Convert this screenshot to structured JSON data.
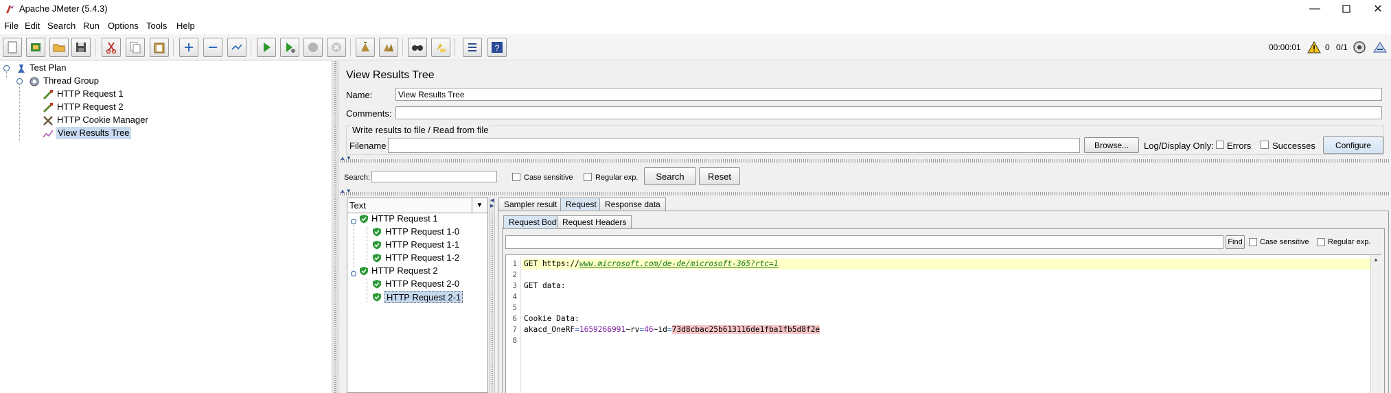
{
  "window": {
    "title": "Apache JMeter (5.4.3)"
  },
  "menu": [
    "File",
    "Edit",
    "Search",
    "Run",
    "Options",
    "Tools",
    "Help"
  ],
  "status": {
    "timer": "00:00:01",
    "warnings": "0",
    "threads": "0/1"
  },
  "tree": {
    "test_plan": "Test Plan",
    "thread_group": "Thread Group",
    "req1": "HTTP Request 1",
    "req2": "HTTP Request 2",
    "cookie": "HTTP Cookie Manager",
    "results": "View Results Tree"
  },
  "panel": {
    "title": "View Results Tree",
    "name_label": "Name:",
    "name_value": "View Results Tree",
    "comments_label": "Comments:",
    "write_title": "Write results to file / Read from file",
    "filename_label": "Filename",
    "browse": "Browse...",
    "log_display": "Log/Display Only:",
    "errors": "Errors",
    "successes": "Successes",
    "configure": "Configure",
    "search_label": "Search:",
    "case_sensitive": "Case sensitive",
    "regex": "Regular exp.",
    "search_btn": "Search",
    "reset_btn": "Reset"
  },
  "results": {
    "renderer": "Text",
    "items": [
      "HTTP Request 1",
      "HTTP Request 1-0",
      "HTTP Request 1-1",
      "HTTP Request 1-2",
      "HTTP Request 2",
      "HTTP Request 2-0",
      "HTTP Request 2-1"
    ]
  },
  "tabs": {
    "sampler": "Sampler result",
    "request": "Request",
    "response": "Response data",
    "request_body": "Request Body",
    "request_headers": "Request Headers"
  },
  "find": {
    "button": "Find",
    "case_sensitive": "Case sensitive",
    "regex": "Regular exp."
  },
  "body": {
    "line_numbers": [
      "1",
      "2",
      "3",
      "4",
      "5",
      "6",
      "7",
      "8"
    ],
    "l1_method": "GET https://",
    "l1_url": "www.microsoft.com/de-de/microsoft-365?rtc=1",
    "l3": "GET data:",
    "l6": "Cookie Data:",
    "l7_key": "akacd_OneRF",
    "l7_eq1": "=",
    "l7_num1": "1659266991",
    "l7_mid1": "~rv",
    "l7_eq2": "=",
    "l7_num2": "46",
    "l7_mid2": "~id",
    "l7_eq3": "=",
    "l7_id": "73d8cbac25b613116de1fba1fb5d8f2e"
  },
  "colors": {
    "selection": "#c7d9ee",
    "highlight_line": "#ffffc8",
    "url": "#1a7a1a",
    "number": "#7a1fa0",
    "id_bg": "#f6c6c6"
  }
}
